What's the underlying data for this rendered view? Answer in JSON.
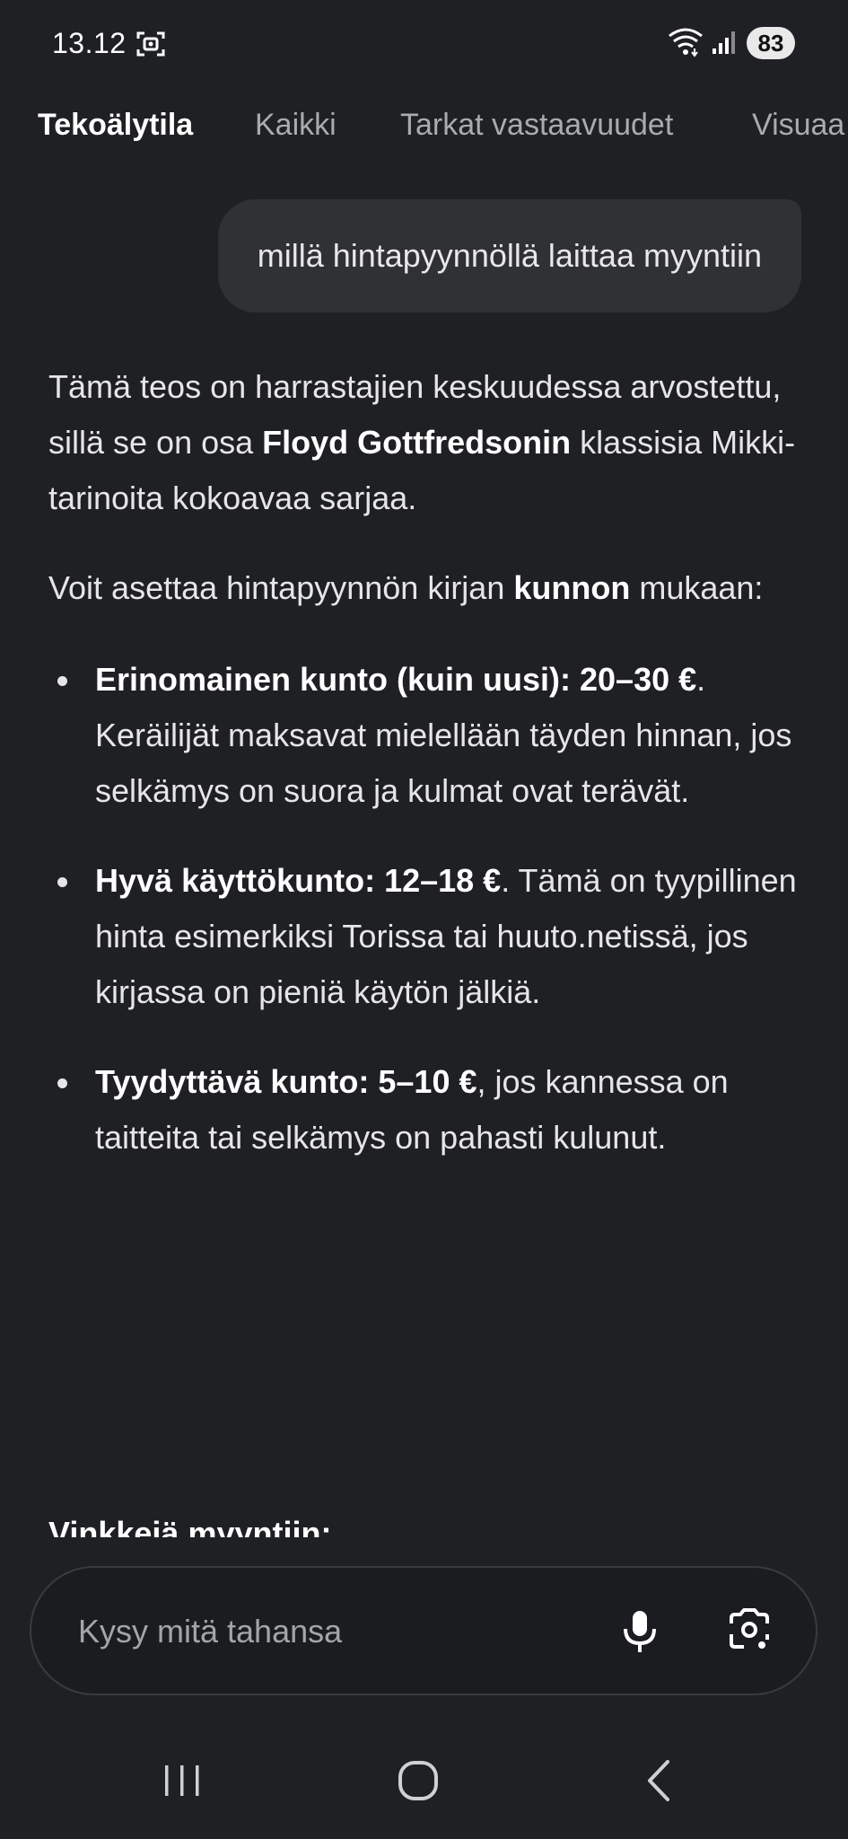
{
  "status_bar": {
    "time": "13.12",
    "battery_level": "83",
    "icons": [
      "screen-record-icon",
      "wifi-icon",
      "signal-icon",
      "battery-icon"
    ]
  },
  "tabs": [
    {
      "label": "Tekoälytila",
      "active": true
    },
    {
      "label": "Kaikki",
      "active": false
    },
    {
      "label": "Tarkat vastaavuudet",
      "active": false
    },
    {
      "label": "Visuaa",
      "active": false
    }
  ],
  "query": "millä hintapyynnöllä laittaa myyntiin",
  "answer": {
    "p1": {
      "before": "Tämä teos on harrastajien keskuudessa arvostettu, sillä se on osa ",
      "bold": "Floyd Gottfredsonin",
      "after": " klassisia Mikki-tarinoita kokoavaa sarjaa."
    },
    "p2": {
      "before": "Voit asettaa hintapyynnön kirjan ",
      "bold": "kunnon",
      "after": " mukaan:"
    },
    "items": [
      {
        "bold": "Erinomainen kunto (kuin uusi): 20–30 €",
        "text": ". Keräilijät maksavat mielellään täyden hinnan, jos selkämys on suora ja kulmat ovat terävät."
      },
      {
        "bold": "Hyvä käyttökunto: 12–18 €",
        "text": ". Tämä on tyypillinen hinta esimerkiksi Torissa tai huuto.netissä, jos kirjassa on pieniä käytön jälkiä."
      },
      {
        "bold": "Tyydyttävä kunto: 5–10 €",
        "text": ", jos kannessa on taitteita tai selkämys on pahasti kulunut."
      }
    ],
    "next_heading": "Vinkkejä myyntiin:"
  },
  "ask_bar": {
    "placeholder": "Kysy mitä tahansa"
  },
  "colors": {
    "background": "#1f2023",
    "bubble": "#303134",
    "text": "#e6e6e8",
    "muted": "#a9abaf"
  }
}
